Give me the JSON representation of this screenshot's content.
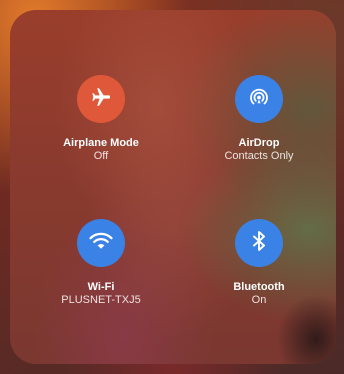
{
  "colors": {
    "airplane_active": "#e0583a",
    "blue_active": "#3b82e6"
  },
  "tiles": [
    {
      "id": "airplane",
      "icon": "airplane-icon",
      "label": "Airplane Mode",
      "status": "Off"
    },
    {
      "id": "airdrop",
      "icon": "airdrop-icon",
      "label": "AirDrop",
      "status": "Contacts Only"
    },
    {
      "id": "wifi",
      "icon": "wifi-icon",
      "label": "Wi-Fi",
      "status": "PLUSNET-TXJ5"
    },
    {
      "id": "bluetooth",
      "icon": "bluetooth-icon",
      "label": "Bluetooth",
      "status": "On"
    }
  ]
}
